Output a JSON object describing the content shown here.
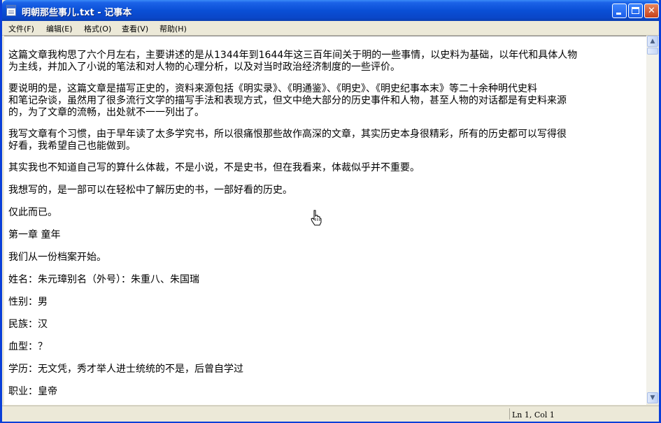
{
  "window": {
    "title": "明朝那些事儿.txt - 记事本",
    "icon": "notepad-icon"
  },
  "menu": [
    "文件(F)",
    "编辑(E)",
    "格式(O)",
    "查看(V)",
    "帮助(H)"
  ],
  "content": {
    "lines": [
      "这篇文章我构思了六个月左右，主要讲述的是从1344年到1644年这三百年间关于明的一些事情，以史料为基础，以年代和具体人物",
      "为主线，并加入了小说的笔法和对人物的心理分析，以及对当时政治经济制度的一些评价。",
      "要说明的是，这篇文章是描写正史的，资料来源包括《明实录》、《明通鉴》、《明史》、《明史纪事本末》等二十余种明代史料",
      "和笔记杂谈，虽然用了很多流行文学的描写手法和表现方式，但文中绝大部分的历史事件和人物，甚至人物的对话都是有史料来源",
      "的，为了文章的流畅，出处就不一一列出了。",
      "我写文章有个习惯，由于早年读了太多学究书，所以很痛恨那些故作高深的文章，其实历史本身很精彩，所有的历史都可以写得很",
      "好看，我希望自己也能做到。",
      "其实我也不知道自己写的算什么体裁，不是小说，不是史书，但在我看来，体裁似乎并不重要。",
      "我想写的，是一部可以在轻松中了解历史的书，一部好看的历史。",
      "仅此而已。",
      "第一章 童年",
      "我们从一份档案开始。",
      "姓名：朱元璋别名（外号）：朱重八、朱国瑞",
      "性别：男",
      "民族：汉",
      "血型：？",
      "学历：无文凭，秀才举人进士统统的不是，后曾自学过",
      "职业：皇帝"
    ]
  },
  "status": {
    "position": "Ln 1, Col 1"
  },
  "icons": {
    "minimize": "minimize-icon",
    "maximize": "maximize-icon",
    "close": "close-icon",
    "cursor": "hand-cursor-icon"
  },
  "colors": {
    "titlebar": "#0a4fd6",
    "close_button": "#c7411a",
    "chrome": "#ece9d8"
  }
}
